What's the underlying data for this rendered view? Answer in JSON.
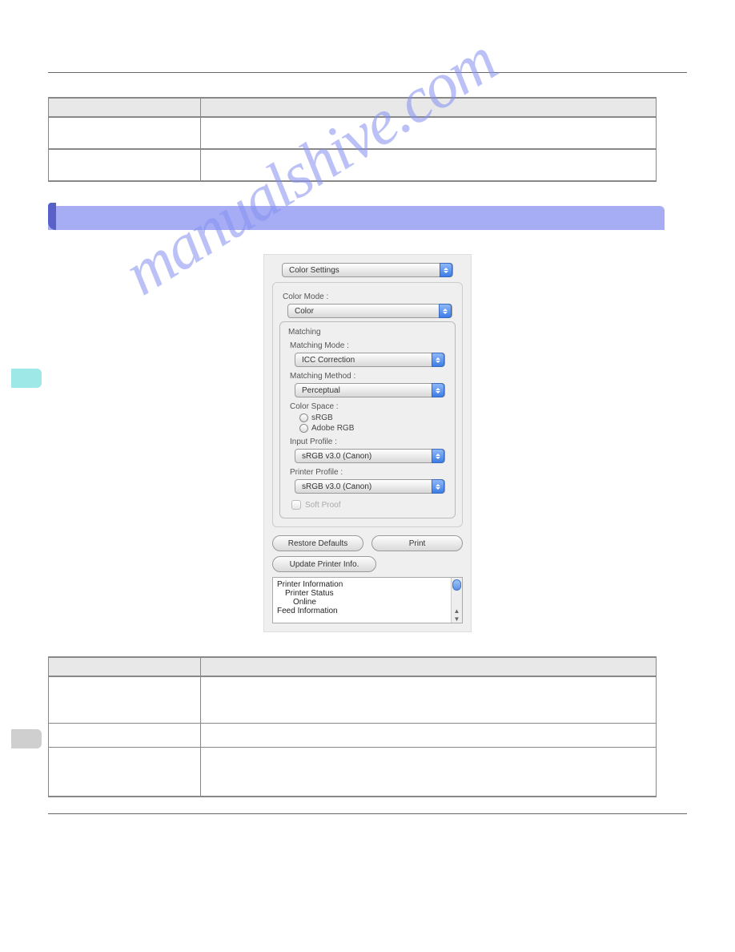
{
  "dialog": {
    "top_select": "Color Settings",
    "color_mode_label": "Color Mode :",
    "color_mode_value": "Color",
    "matching_legend": "Matching",
    "matching_mode_label": "Matching Mode :",
    "matching_mode_value": "ICC Correction",
    "matching_method_label": "Matching Method :",
    "matching_method_value": "Perceptual",
    "color_space_label": "Color Space :",
    "radio1": "sRGB",
    "radio2": "Adobe RGB",
    "input_profile_label": "Input Profile :",
    "input_profile_value": "sRGB v3.0 (Canon)",
    "printer_profile_label": "Printer Profile :",
    "printer_profile_value": "sRGB v3.0 (Canon)",
    "soft_proof": "Soft Proof",
    "restore_btn": "Restore Defaults",
    "print_btn": "Print",
    "update_btn": "Update Printer Info.",
    "info_line1": "Printer Information",
    "info_line2": "Printer Status",
    "info_line3": "Online",
    "info_line4": "Feed Information"
  },
  "watermark": "manualshive.com"
}
